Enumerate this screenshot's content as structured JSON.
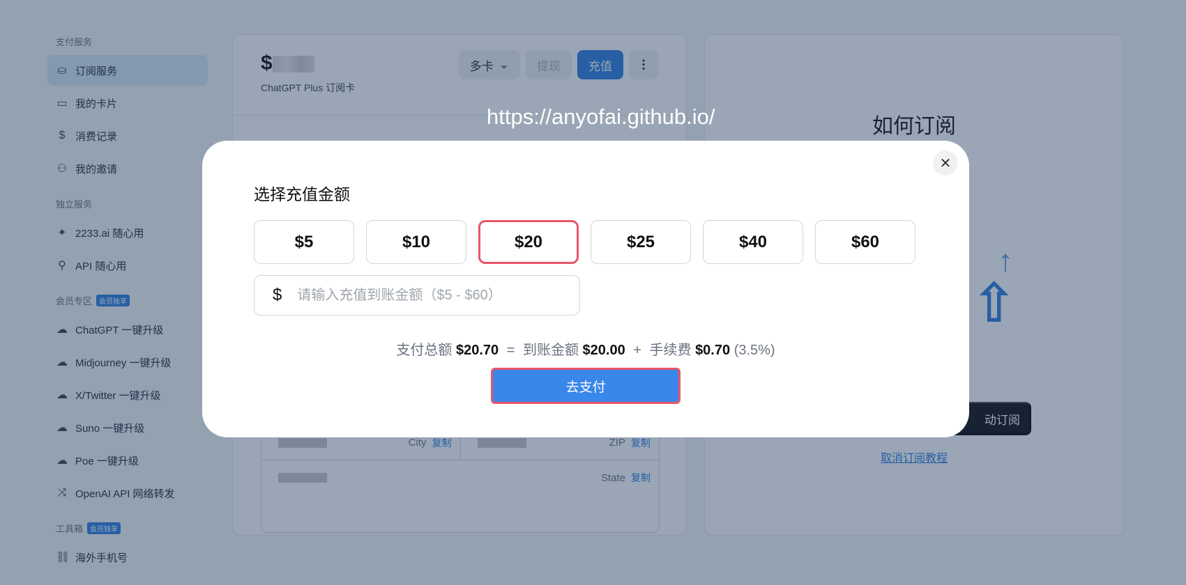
{
  "sidebar": {
    "sections": [
      {
        "title": "支付服务",
        "items": [
          {
            "icon": "hand-coin-icon",
            "glyph": "⛀",
            "label": "订阅服务",
            "active": true
          },
          {
            "icon": "card-icon",
            "glyph": "▭",
            "label": "我的卡片"
          },
          {
            "icon": "dollar-icon",
            "glyph": "$",
            "label": "消费记录"
          },
          {
            "icon": "users-icon",
            "glyph": "⚇",
            "label": "我的邀请"
          }
        ]
      },
      {
        "title": "独立服务",
        "items": [
          {
            "icon": "sparkle-icon",
            "glyph": "✦",
            "label": "2233.ai 随心用"
          },
          {
            "icon": "plug-icon",
            "glyph": "⚲",
            "label": "API 随心用"
          }
        ]
      },
      {
        "title": "会员专区",
        "badge": "会员独享",
        "items": [
          {
            "icon": "upload-cloud-icon",
            "glyph": "☁",
            "label": "ChatGPT 一键升级"
          },
          {
            "icon": "upload-cloud-icon",
            "glyph": "☁",
            "label": "Midjourney 一键升级"
          },
          {
            "icon": "upload-cloud-icon",
            "glyph": "☁",
            "label": "X/Twitter 一键升级"
          },
          {
            "icon": "upload-cloud-icon",
            "glyph": "☁",
            "label": "Suno 一键升级"
          },
          {
            "icon": "upload-cloud-icon",
            "glyph": "☁",
            "label": "Poe 一键升级"
          },
          {
            "icon": "shuffle-icon",
            "glyph": "⤨",
            "label": "OpenAI API 网络转发"
          }
        ]
      },
      {
        "title": "工具箱",
        "badge": "会员独享",
        "items": [
          {
            "icon": "link-icon",
            "glyph": "⛓",
            "label": "海外手机号"
          }
        ]
      }
    ]
  },
  "card": {
    "amount_prefix": "$",
    "subtitle": "ChatGPT Plus 订阅卡",
    "multi_card_label": "多卡",
    "withdraw_label": "提现",
    "recharge_label": "充值",
    "more_glyph": "⋮",
    "fields": [
      [
        {
          "label": "City",
          "copy": "复制"
        },
        {
          "label": "ZIP",
          "copy": "复制"
        }
      ],
      [
        {
          "label": "State",
          "copy": "复制"
        }
      ]
    ]
  },
  "right_panel": {
    "title": "如何订阅",
    "auto_subscribe_label": "动订阅",
    "cancel_link": "取消订阅教程"
  },
  "watermark": "https://anyofai.github.io/",
  "modal": {
    "title": "选择充值金额",
    "close_glyph": "✕",
    "amounts": [
      "$5",
      "$10",
      "$20",
      "$25",
      "$40",
      "$60"
    ],
    "selected_amount": "$20",
    "custom_prefix": "$",
    "custom_placeholder": "请输入充值到账金额（$5 - $60）",
    "custom_value": "",
    "summary": {
      "total_label": "支付总额",
      "total_value": "$20.70",
      "eq": "=",
      "credit_label": "到账金额",
      "credit_value": "$20.00",
      "plus": "+",
      "fee_label": "手续费",
      "fee_value": "$0.70",
      "fee_pct": "(3.5%)"
    },
    "pay_label": "去支付"
  },
  "colors": {
    "accent": "#2f7de1",
    "highlight": "#e8546a"
  }
}
